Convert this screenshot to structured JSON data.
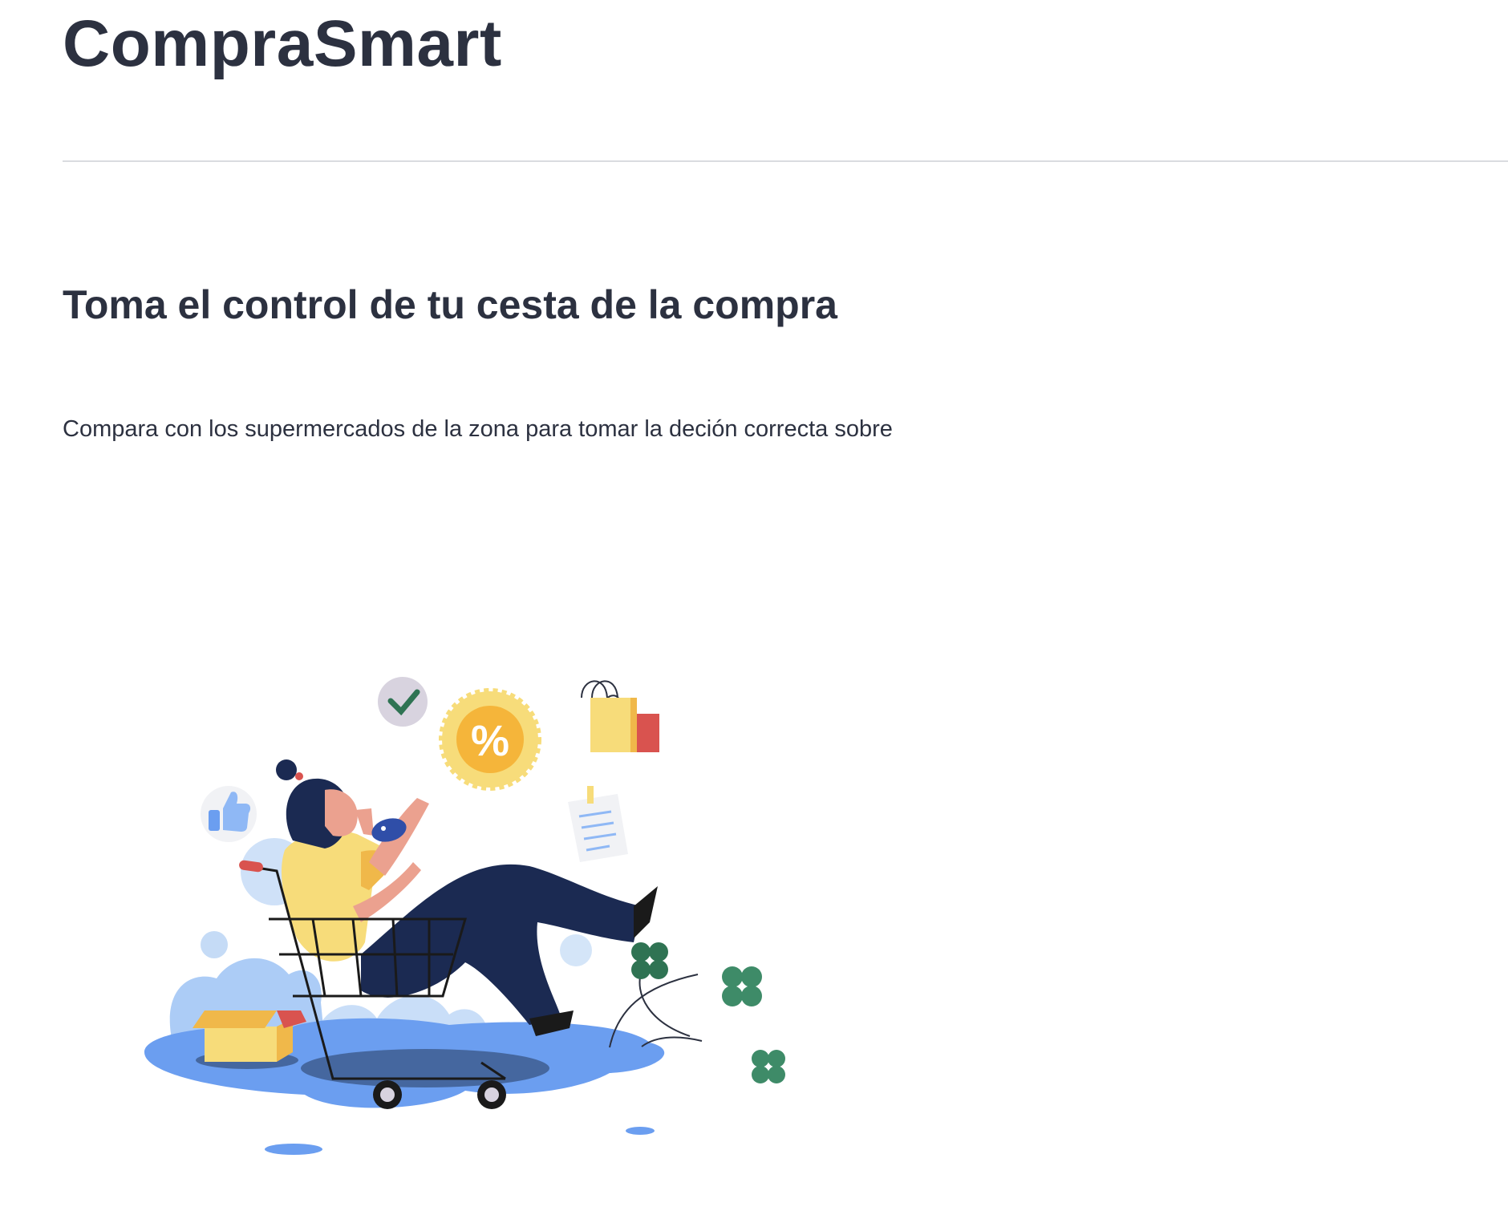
{
  "header": {
    "app_title": "CompraSmart"
  },
  "main": {
    "headline": "Toma el control de tu cesta de la compra",
    "description": "Compara con los supermercados de la zona para tomar la deción correcta sobre",
    "hero_illustration": {
      "discount_symbol": "%"
    }
  },
  "colors": {
    "text": "#2c3140",
    "divider": "#dadce0",
    "puddle": "#6b9ef0",
    "shirt": "#f7dc7a",
    "pants": "#1b2a52",
    "badge": "#f5b53a",
    "leaf": "#3e8b68",
    "bag_red": "#d9534f"
  },
  "icons": [
    "check-icon",
    "thumbs-up-icon",
    "percent-badge-icon",
    "shopping-bag-icon",
    "note-icon",
    "shopping-cart-icon",
    "box-icon",
    "clover-icon"
  ]
}
